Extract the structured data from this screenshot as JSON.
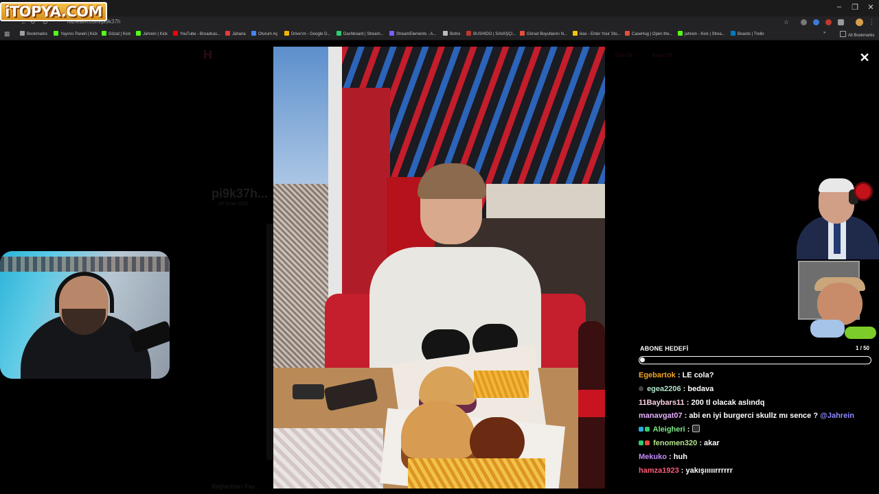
{
  "watermark": {
    "text": "iTOPYA.COM"
  },
  "browser": {
    "url": "hizresim.com/pi9k37h",
    "window_controls": [
      "–",
      "❐",
      "✕"
    ],
    "bookmarks": [
      {
        "label": "Bookmarks",
        "color": "#9aa0a6"
      },
      {
        "label": "Yayıncı Paneli | Kick",
        "color": "#53fc18"
      },
      {
        "label": "Gözat | Kick",
        "color": "#53fc18"
      },
      {
        "label": "Jahrein | Kick",
        "color": "#53fc18"
      },
      {
        "label": "YouTube - Broadcas...",
        "color": "#ff0000"
      },
      {
        "label": "Jaharia",
        "color": "#e23b3b"
      },
      {
        "label": "Oturum Aç",
        "color": "#4285f4"
      },
      {
        "label": "Drive'ım - Google D...",
        "color": "#f4b400"
      },
      {
        "label": "Dashboard | Stream...",
        "color": "#2ecc71"
      },
      {
        "label": "StreamElements - A...",
        "color": "#7b5cff"
      },
      {
        "label": "Botrix",
        "color": "#bbbbbb"
      },
      {
        "label": "BUSHIDO | SAVAŞÇI...",
        "color": "#c0392b"
      },
      {
        "label": "Görsel Boyutlarını N...",
        "color": "#e74c3c"
      },
      {
        "label": "ikas - Enter Your Sto...",
        "color": "#f1c40f"
      },
      {
        "label": "CaseHug | Open the...",
        "color": "#e74c3c"
      },
      {
        "label": "jahrein - Kick | Strea...",
        "color": "#53fc18"
      },
      {
        "label": "Boards | Trello",
        "color": "#0079bf"
      }
    ],
    "all_bookmarks": "All Bookmarks"
  },
  "page": {
    "title_ghost": "pi9k37h...",
    "date_ghost": "29 Ocak 2025",
    "share_ghost": "Bağlantıları Pay...",
    "nav_ghost": [
      "Üye Ol",
      "Kayıt Ol"
    ]
  },
  "overlay": {
    "goal": {
      "title": "ABONE HEDEFİ",
      "count": "1 / 50",
      "progress": 0.02
    },
    "chat": [
      {
        "user": "Egebartok",
        "color": "#f5a623",
        "text": "LE cola?",
        "badges": []
      },
      {
        "user": "egea2206",
        "color": "#b0e3c9",
        "text": "bedava",
        "badges": [
          "#444444"
        ]
      },
      {
        "user": "11Baybars11",
        "color": "#ffd1e6",
        "text": "200 tl olacak aslındq",
        "badges": []
      },
      {
        "user": "manavgat07",
        "color": "#e6b3ff",
        "text": "abi en iyi burgerci skullz mı sence ?",
        "mention": "@Jahrein",
        "badges": []
      },
      {
        "user": "Aleigheri",
        "color": "#7ee787",
        "text": "",
        "emote": true,
        "badges": [
          "#2aa9e0",
          "#2ecc71"
        ]
      },
      {
        "user": "fenomen320",
        "color": "#b5e28a",
        "text": "akar",
        "badges": [
          "#2ecc71",
          "#e74c3c"
        ]
      },
      {
        "user": "Mekuko",
        "color": "#c58bff",
        "text": "huh",
        "badges": []
      },
      {
        "user": "hamza1923",
        "color": "#ff5c7a",
        "text": "yakışııııırrrrrr",
        "badges": []
      }
    ]
  }
}
